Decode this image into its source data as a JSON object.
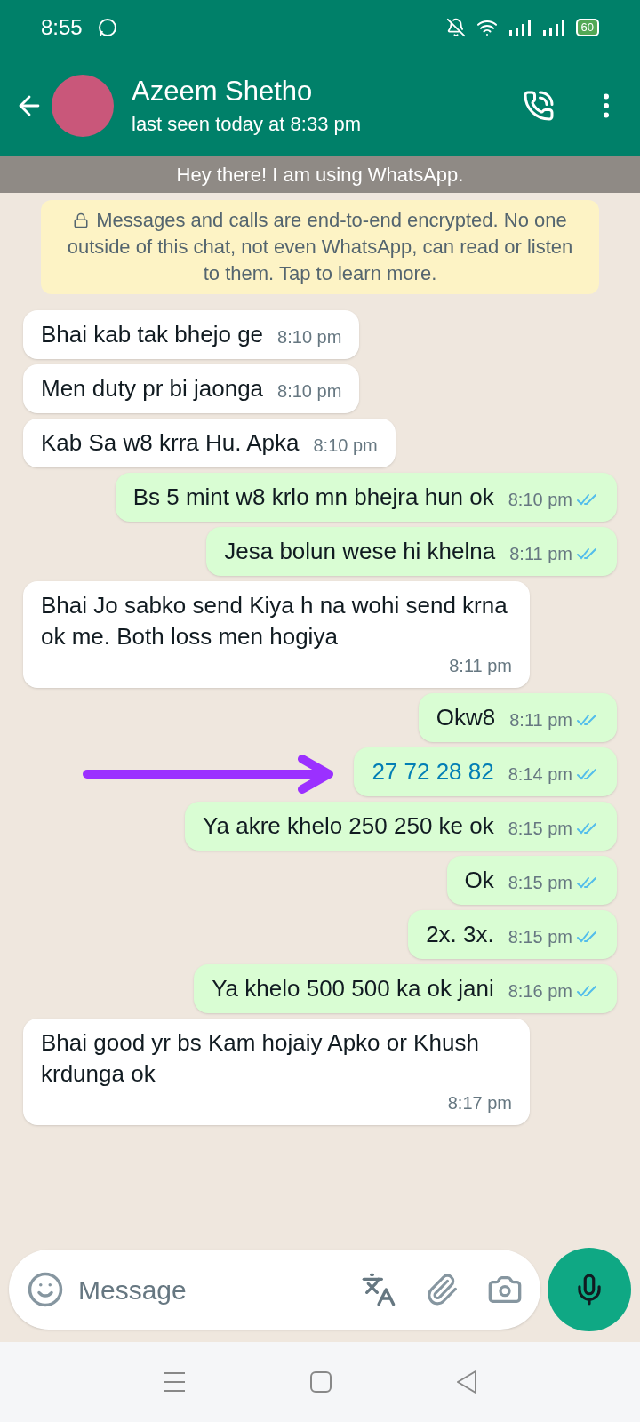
{
  "status_bar": {
    "time": "8:55",
    "battery": "60"
  },
  "header": {
    "name": "Azeem Shetho",
    "last_seen": "last seen today at 8:33 pm"
  },
  "about_toast": "Hey there! I am using WhatsApp.",
  "encryption_notice": "Messages and calls are end-to-end encrypted. No one outside of this chat, not even WhatsApp, can read or listen to them. Tap to learn more.",
  "messages": [
    {
      "kind": "in",
      "text": "Bhai kab tak bhejo ge",
      "time": "8:10 pm"
    },
    {
      "kind": "in",
      "text": "Men duty pr bi jaonga",
      "time": "8:10 pm"
    },
    {
      "kind": "in",
      "text": "Kab Sa w8 krra Hu. Apka",
      "time": "8:10 pm"
    },
    {
      "kind": "out",
      "text": "Bs 5 mint w8 krlo mn bhejra hun ok",
      "time": "8:10 pm",
      "read": true,
      "link": false
    },
    {
      "kind": "out",
      "text": "Jesa bolun wese hi khelna",
      "time": "8:11 pm",
      "read": true,
      "link": false
    },
    {
      "kind": "in",
      "text": "Bhai Jo sabko send Kiya h na wohi send krna ok me. Both loss men hogiya",
      "time": "8:11 pm"
    },
    {
      "kind": "out",
      "text": "Okw8",
      "time": "8:11 pm",
      "read": true,
      "link": false
    },
    {
      "kind": "out",
      "text": "27 72 28 82",
      "time": "8:14 pm",
      "read": true,
      "link": true
    },
    {
      "kind": "out",
      "text": "Ya akre khelo 250 250 ke ok",
      "time": "8:15 pm",
      "read": true,
      "link": false
    },
    {
      "kind": "out",
      "text": "Ok",
      "time": "8:15 pm",
      "read": true,
      "link": false
    },
    {
      "kind": "out",
      "text": "2x. 3x.",
      "time": "8:15 pm",
      "read": true,
      "link": false
    },
    {
      "kind": "out",
      "text": "Ya khelo 500 500 ka ok jani",
      "time": "8:16 pm",
      "read": true,
      "link": false
    },
    {
      "kind": "in",
      "text": "Bhai good yr bs Kam hojaiy Apko or Khush krdunga ok",
      "time": "8:17 pm"
    }
  ],
  "composer": {
    "placeholder": "Message"
  }
}
